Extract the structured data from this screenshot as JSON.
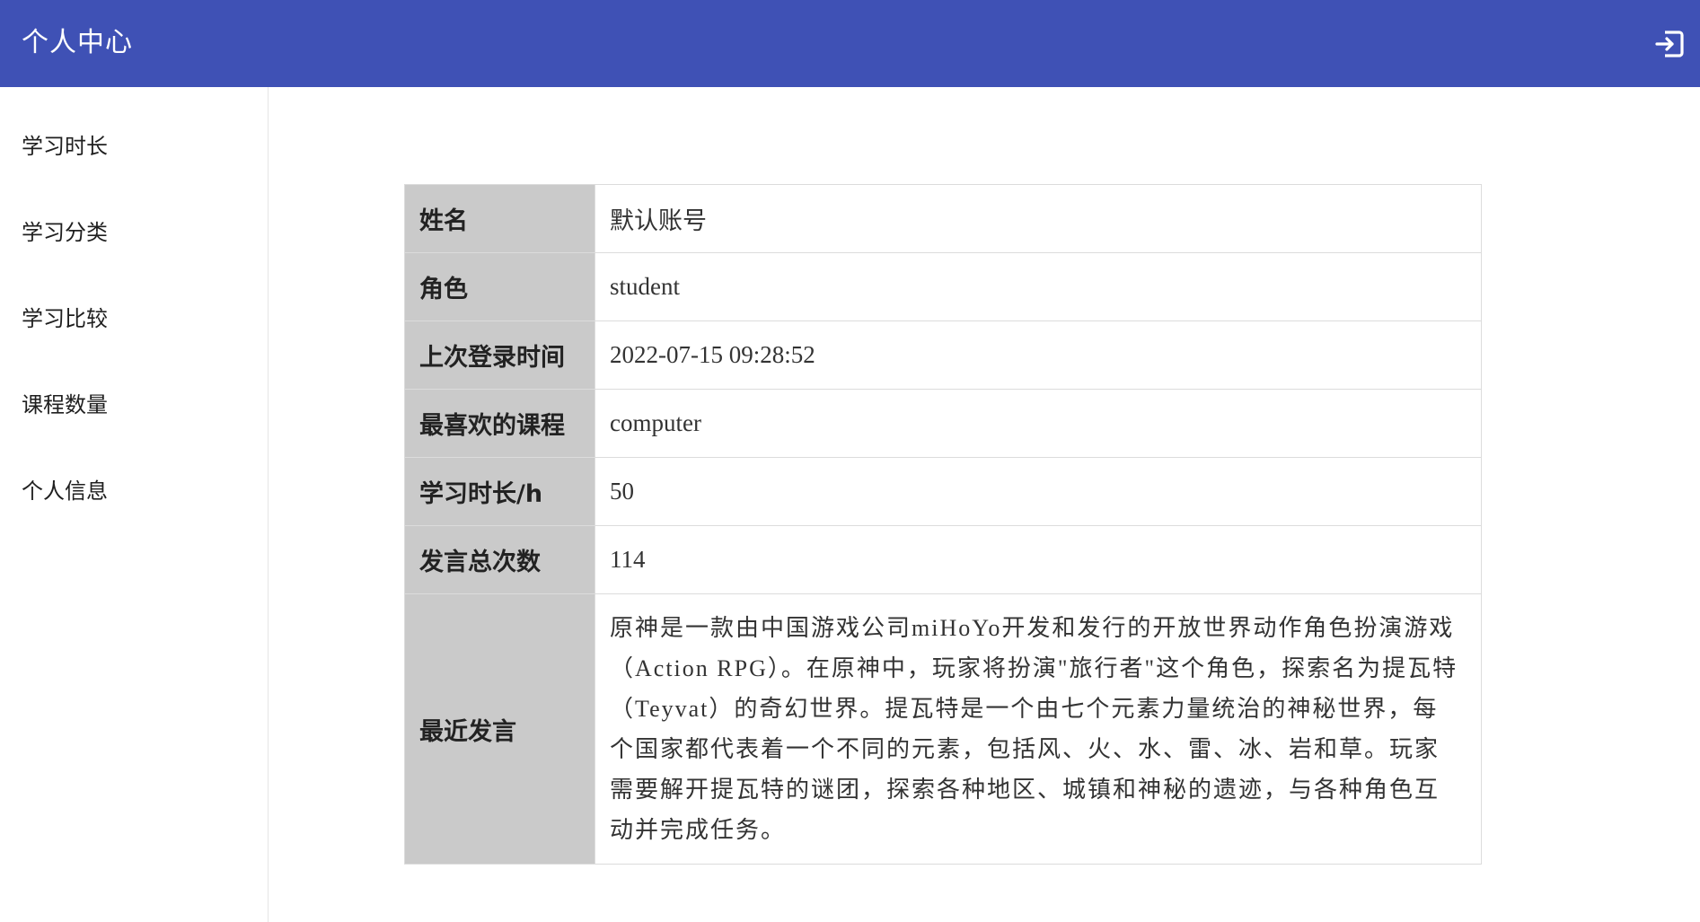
{
  "header": {
    "title": "个人中心",
    "logout_icon": "logout-icon"
  },
  "sidebar": {
    "items": [
      {
        "label": "学习时长"
      },
      {
        "label": "学习分类"
      },
      {
        "label": "学习比较"
      },
      {
        "label": "课程数量"
      },
      {
        "label": "个人信息"
      }
    ]
  },
  "profile": {
    "rows": [
      {
        "label": "姓名",
        "value": "默认账号"
      },
      {
        "label": "角色",
        "value": "student"
      },
      {
        "label": "上次登录时间",
        "value": "2022-07-15 09:28:52"
      },
      {
        "label": "最喜欢的课程",
        "value": "computer"
      },
      {
        "label": "学习时长/h",
        "value": "50"
      },
      {
        "label": "发言总次数",
        "value": "114"
      },
      {
        "label": "最近发言",
        "value": "原神是一款由中国游戏公司miHoYo开发和发行的开放世界动作角色扮演游戏（Action RPG）。在原神中，玩家将扮演\"旅行者\"这个角色，探索名为提瓦特（Teyvat）的奇幻世界。提瓦特是一个由七个元素力量统治的神秘世界，每个国家都代表着一个不同的元素，包括风、火、水、雷、冰、岩和草。玩家需要解开提瓦特的谜团，探索各种地区、城镇和神秘的遗迹，与各种角色互动并完成任务。"
      }
    ]
  },
  "colors": {
    "header_bg": "#3f51b5",
    "label_bg": "#cacaca",
    "border": "#dcdcdc"
  }
}
